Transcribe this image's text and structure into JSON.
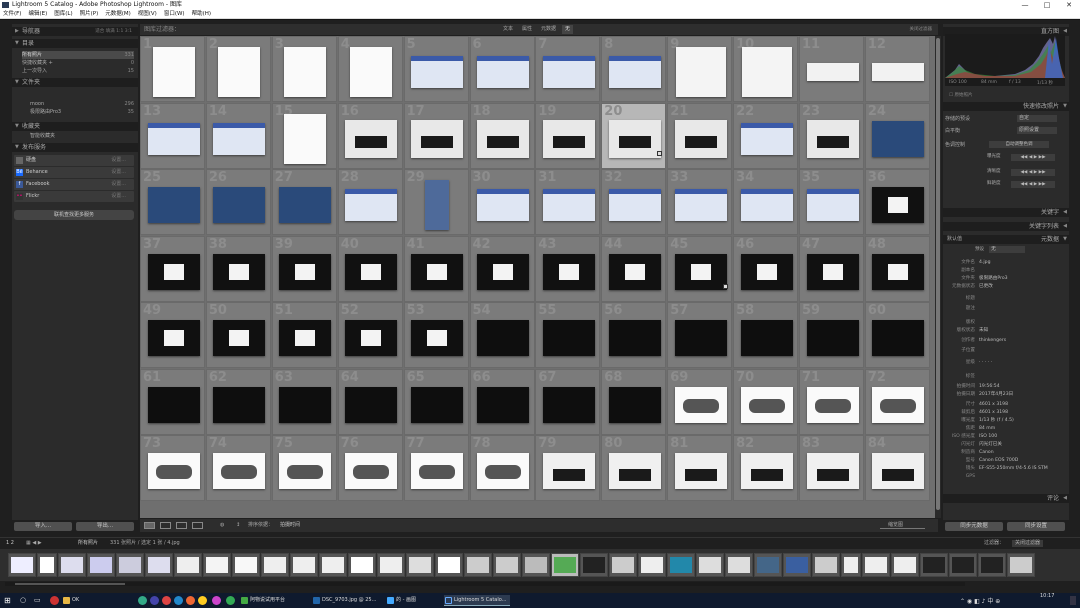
{
  "window": {
    "title": "Lightroom 5 Catalog - Adobe Photoshop Lightroom - 图库",
    "controls": [
      "—",
      "□",
      "✕"
    ]
  },
  "menu": [
    "文件(F)",
    "编辑(E)",
    "图库(L)",
    "照片(P)",
    "元数据(M)",
    "视图(V)",
    "窗口(W)",
    "帮助(H)"
  ],
  "navigator": {
    "title": "导航器",
    "zoom_options": "适合  填满  1:1  3:1"
  },
  "catalog": {
    "title": "目录",
    "items": [
      {
        "label": "所有照片",
        "count": "331"
      },
      {
        "label": "快捷收藏夹 +",
        "count": "0"
      },
      {
        "label": "上一次导入",
        "count": "15"
      }
    ]
  },
  "folders": {
    "title": "文件夹",
    "items": [
      {
        "label": "moon",
        "count": "296"
      },
      {
        "label": "极限路由Pro3",
        "count": "35"
      }
    ]
  },
  "collections": {
    "title": "收藏夹",
    "items": [
      {
        "label": "智能收藏夹"
      }
    ]
  },
  "publish": {
    "title": "发布服务",
    "services": [
      {
        "badge": "",
        "label": "硬盘",
        "setting": "设置..."
      },
      {
        "badge": "Bē",
        "label": "Behance",
        "setting": "设置..."
      },
      {
        "badge": "f",
        "label": "Facebook",
        "setting": "设置..."
      },
      {
        "badge": "••",
        "label": "Flickr",
        "setting": "设置..."
      }
    ],
    "find_more": "联机查找更多服务"
  },
  "left_buttons": {
    "import": "导入...",
    "export": "导出..."
  },
  "filter": {
    "title": "图库过滤器：",
    "tabs": [
      "文本",
      "属性",
      "元数据",
      "无"
    ],
    "active_tab": "无",
    "preset": "关闭过滤器"
  },
  "grid_numbers": [
    "1",
    "2",
    "3",
    "4",
    "5",
    "6",
    "7",
    "8",
    "9",
    "10",
    "11",
    "12",
    "13",
    "14",
    "15",
    "16",
    "17",
    "18",
    "19",
    "20",
    "21",
    "22",
    "23",
    "24",
    "25",
    "26",
    "27",
    "28",
    "29",
    "30",
    "31",
    "32",
    "33",
    "34",
    "35",
    "36",
    "37",
    "38",
    "39",
    "40",
    "41",
    "42",
    "43",
    "44",
    "45",
    "46",
    "47",
    "48",
    "49",
    "50",
    "51",
    "52",
    "53",
    "54",
    "55",
    "56",
    "57",
    "58",
    "59",
    "60",
    "61",
    "62",
    "63",
    "64",
    "65",
    "66",
    "67",
    "68",
    "69",
    "70",
    "71",
    "72",
    "73",
    "74",
    "75",
    "76",
    "77",
    "78",
    "79",
    "80",
    "81",
    "82",
    "83",
    "84"
  ],
  "toolbar": {
    "sort_label": "排序依据：",
    "sort_value": "拍摄时间",
    "thumbs_label": "缩览图"
  },
  "histogram": {
    "title": "直方图",
    "iso": "ISO 100",
    "focal": "84 mm",
    "aperture": "f / 13",
    "shutter": "1/13 秒",
    "original": "原始照片"
  },
  "quick_develop": {
    "title": "快速修改照片",
    "rows": [
      {
        "label": "存储的预设",
        "value": "自定"
      },
      {
        "label": "白平衡",
        "value": "原照设置"
      }
    ],
    "tone_label": "色调控制",
    "auto_tone": "自动调整色调",
    "sliders": [
      "曝光度",
      "清晰度",
      "鲜艳度"
    ]
  },
  "keywords": {
    "title": "关键字",
    "list_title": "关键字列表"
  },
  "metadata": {
    "title": "元数据",
    "preset_label": "默认值",
    "filter_label": "预设",
    "filter_value": "无",
    "rows": [
      {
        "k": "文件名",
        "v": "4.jpg"
      },
      {
        "k": "副本名",
        "v": ""
      },
      {
        "k": "文件夹",
        "v": "极限路由Pro3"
      },
      {
        "k": "元数据状态",
        "v": "已更改"
      },
      {
        "k": "标题",
        "v": ""
      },
      {
        "k": "题注",
        "v": ""
      },
      {
        "k": "版权",
        "v": ""
      },
      {
        "k": "版权状态",
        "v": "未知"
      },
      {
        "k": "创作者",
        "v": "thinkengers"
      },
      {
        "k": "子位置",
        "v": ""
      },
      {
        "k": "星级",
        "v": "· · · · ·"
      },
      {
        "k": "标签",
        "v": ""
      },
      {
        "k": "拍摄时间",
        "v": "19:56:54"
      },
      {
        "k": "拍摄日期",
        "v": "2017年4月23日"
      },
      {
        "k": "尺寸",
        "v": "4601 x 3198"
      },
      {
        "k": "裁剪后",
        "v": "4601 x 3198"
      },
      {
        "k": "曝光度",
        "v": "1/13 秒 (f / 4.5)"
      },
      {
        "k": "焦距",
        "v": "84 mm"
      },
      {
        "k": "ISO 感光度",
        "v": "ISO 100"
      },
      {
        "k": "闪光灯",
        "v": "闪光灯已关"
      },
      {
        "k": "制造商",
        "v": "Canon"
      },
      {
        "k": "型号",
        "v": "Canon EOS 700D"
      },
      {
        "k": "镜头",
        "v": "EF-S55-250mm f/4-5.6 IS STM"
      },
      {
        "k": "GPS",
        "v": ""
      }
    ]
  },
  "comments": {
    "title": "评论"
  },
  "right_buttons": {
    "sync_meta": "同步元数据",
    "sync_settings": "同步设置"
  },
  "filmstrip_bar": {
    "monitors": "1 2",
    "source": "所有照片",
    "info": "331 张照片 / 选定 1 张 / 4.jpg",
    "filter_label": "过滤器：",
    "filter_value": "关闭过滤器"
  },
  "taskbar": {
    "items": [
      "OK",
      "",
      "",
      "",
      "",
      "阿物说试用平台",
      "DSC_9703.jpg @ 25...",
      "的 - 画图",
      "Lightroom 5 Catalo..."
    ],
    "time": "10:17",
    "date": "2017/..."
  }
}
